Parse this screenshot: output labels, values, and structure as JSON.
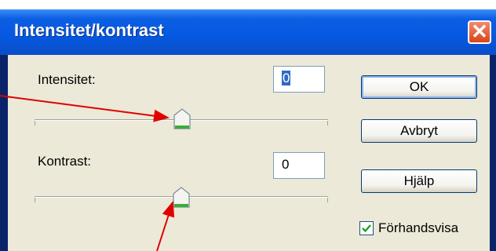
{
  "dialog": {
    "title": "Intensitet/kontrast",
    "close_glyph": "✕"
  },
  "intensity": {
    "label": "Intensitet:",
    "value": "0",
    "slider_value": 0
  },
  "contrast": {
    "label": "Kontrast:",
    "value": "0",
    "slider_value": 0
  },
  "buttons": {
    "ok": "OK",
    "cancel": "Avbryt",
    "help": "Hjälp"
  },
  "preview": {
    "label": "Förhandsvisa",
    "checked": true
  },
  "colors": {
    "annotation_arrow": "#e00000",
    "titlebar": "#0558e0",
    "close_button": "#e1582f"
  },
  "icons": [
    "close-icon",
    "slider-thumb-icon",
    "checkmark-icon"
  ]
}
